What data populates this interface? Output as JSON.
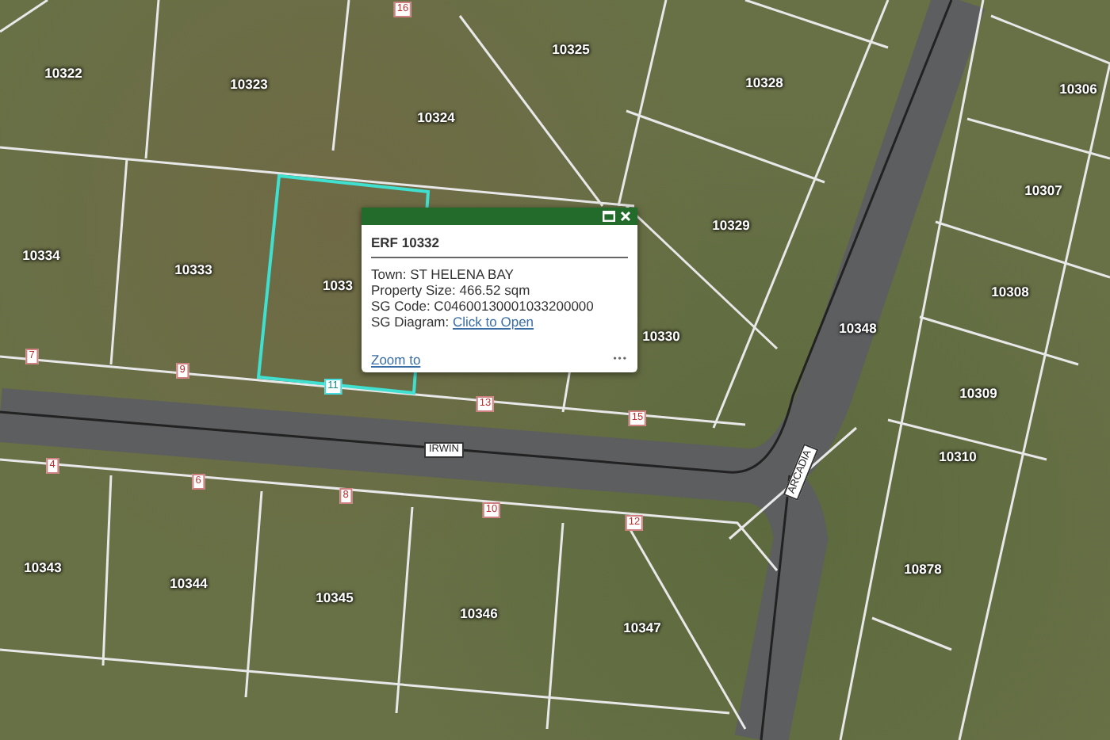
{
  "map": {
    "parcels": [
      {
        "label": "10322"
      },
      {
        "label": "10323"
      },
      {
        "label": "10324"
      },
      {
        "label": "10325"
      },
      {
        "label": "10328"
      },
      {
        "label": "10306"
      },
      {
        "label": "10334"
      },
      {
        "label": "10333"
      },
      {
        "label": "1033"
      },
      {
        "label": "10329"
      },
      {
        "label": "10307"
      },
      {
        "label": "10330"
      },
      {
        "label": "10308"
      },
      {
        "label": "10348"
      },
      {
        "label": "10309"
      },
      {
        "label": "10310"
      },
      {
        "label": "10343"
      },
      {
        "label": "10344"
      },
      {
        "label": "10345"
      },
      {
        "label": "10346"
      },
      {
        "label": "10347"
      },
      {
        "label": "10878"
      }
    ],
    "house_numbers": [
      {
        "label": "16"
      },
      {
        "label": "7"
      },
      {
        "label": "9"
      },
      {
        "label": "11"
      },
      {
        "label": "13"
      },
      {
        "label": "15"
      },
      {
        "label": "4"
      },
      {
        "label": "6"
      },
      {
        "label": "8"
      },
      {
        "label": "10"
      },
      {
        "label": "12"
      }
    ],
    "streets": [
      {
        "name": "IRWIN"
      },
      {
        "name": "ARCADIA"
      }
    ]
  },
  "popup": {
    "title": "ERF 10332",
    "fields": [
      {
        "label": "Town:",
        "value": "ST HELENA BAY",
        "kind": "text"
      },
      {
        "label": "Property Size:",
        "value": "466.52 sqm",
        "kind": "text"
      },
      {
        "label": "SG Code:",
        "value": "C04600130001033200000",
        "kind": "text"
      },
      {
        "label": "SG Diagram:",
        "value": "Click to Open",
        "kind": "link"
      }
    ],
    "zoom_link": "Zoom to",
    "more": "•••"
  }
}
